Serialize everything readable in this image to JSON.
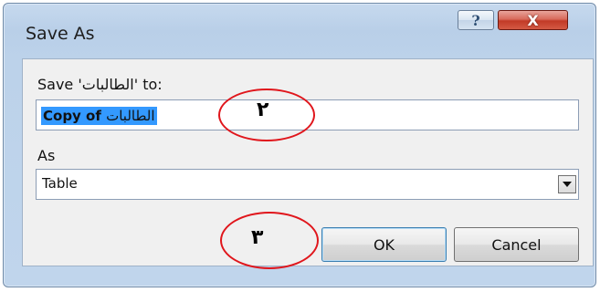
{
  "window": {
    "title": "Save As",
    "help_glyph": "?",
    "close_glyph": "X"
  },
  "form": {
    "save_label": "Save 'الطالبات' to:",
    "name_value_prefix": "Copy of ",
    "name_value_name": "الطالبات",
    "as_label": "As",
    "as_value": "Table"
  },
  "buttons": {
    "ok": "OK",
    "cancel": "Cancel"
  },
  "annotations": {
    "marker_2": "٢",
    "marker_3": "٣",
    "color": "#e0161c"
  },
  "icons": {
    "help": "question-mark-icon",
    "close": "close-icon",
    "dropdown": "chevron-down-icon"
  }
}
